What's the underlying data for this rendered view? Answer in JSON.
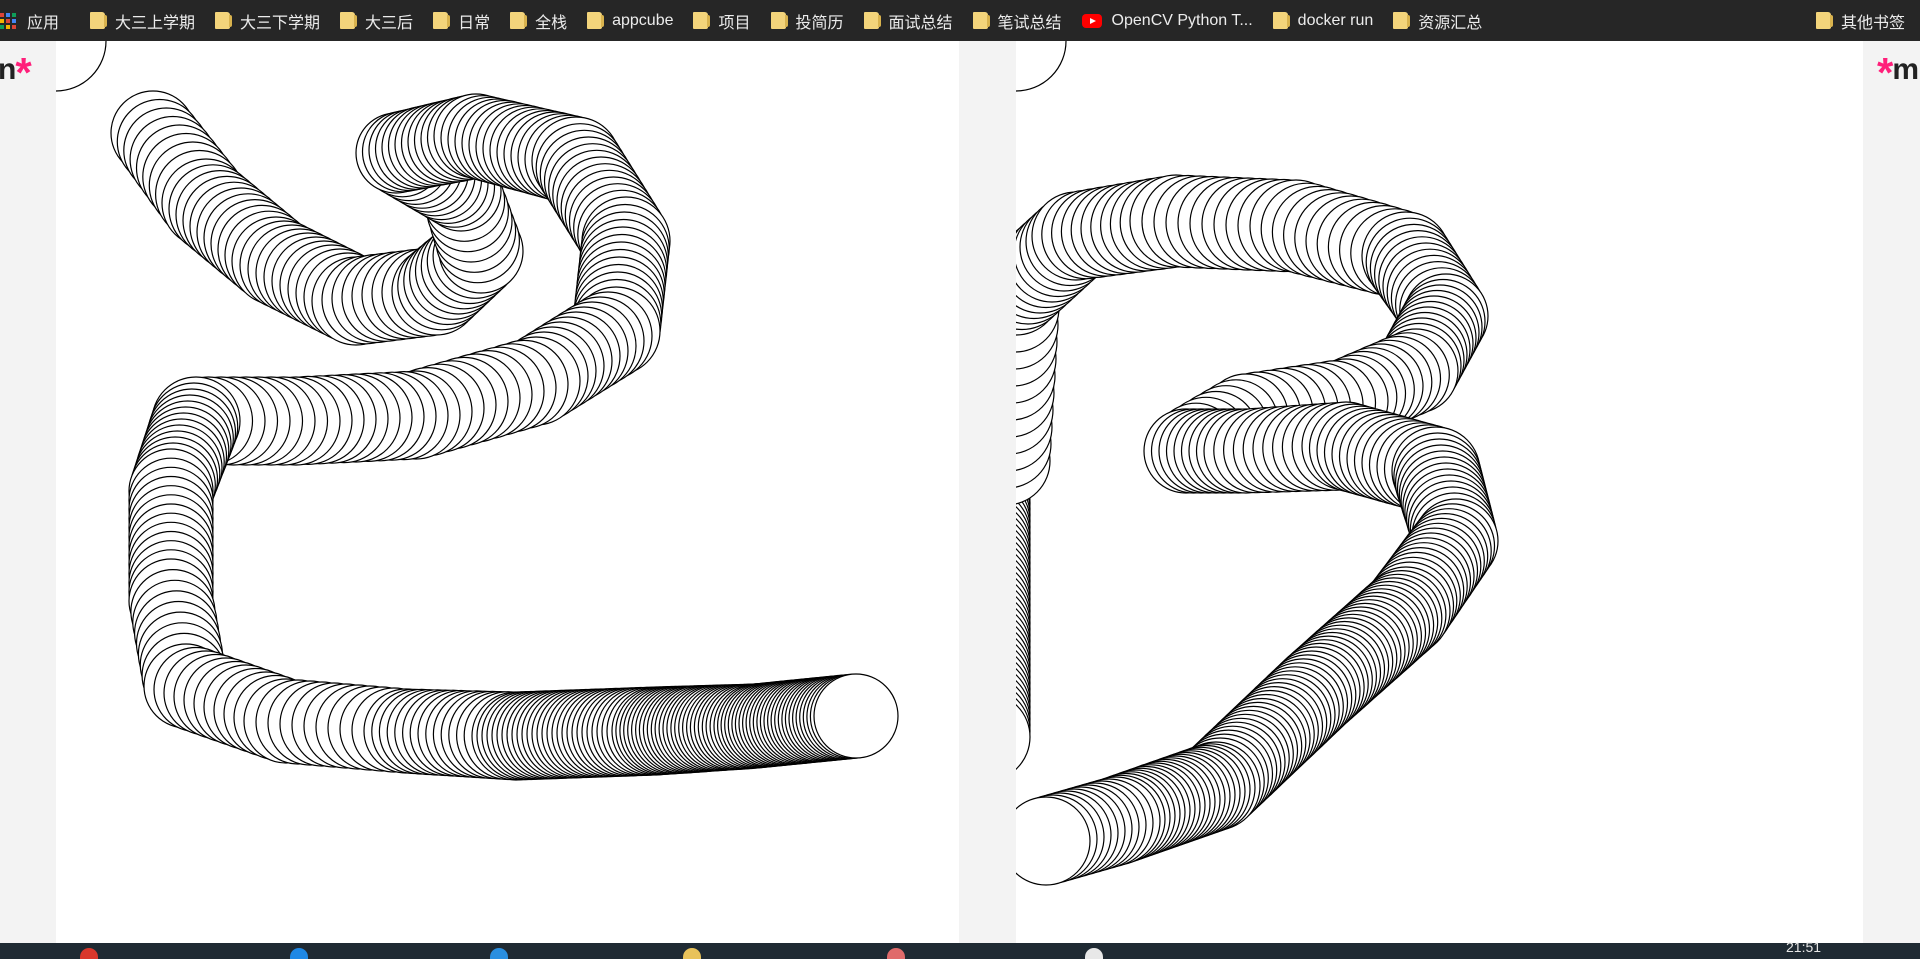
{
  "bookmarks_bar": {
    "apps_label": "应用",
    "apps_grid_colors": [
      "#db4437",
      "#4285f4",
      "#0f9d58",
      "#f4b400",
      "#db4437",
      "#4285f4",
      "#0f9d58",
      "#f4b400",
      "#db4437"
    ],
    "items": [
      {
        "label": "大三上学期",
        "icon": "folder-icon"
      },
      {
        "label": "大三下学期",
        "icon": "folder-icon"
      },
      {
        "label": "大三后",
        "icon": "folder-icon"
      },
      {
        "label": "日常",
        "icon": "folder-icon"
      },
      {
        "label": "全栈",
        "icon": "folder-icon"
      },
      {
        "label": "appcube",
        "icon": "folder-icon"
      },
      {
        "label": "项目",
        "icon": "folder-icon"
      },
      {
        "label": "投简历",
        "icon": "folder-icon"
      },
      {
        "label": "面试总结",
        "icon": "folder-icon"
      },
      {
        "label": "笔试总结",
        "icon": "folder-icon"
      },
      {
        "label": "OpenCV Python T...",
        "icon": "youtube-icon"
      },
      {
        "label": "docker run",
        "icon": "folder-icon"
      },
      {
        "label": "资源汇总",
        "icon": "folder-icon"
      }
    ],
    "other_bookmarks": "其他书签"
  },
  "page": {
    "brand_left": {
      "letter": "n",
      "star": "*"
    },
    "brand_right": {
      "letter": "m",
      "star": "*"
    },
    "brand_star_color": "#ff1f7a",
    "drawing_left_glyph": "2",
    "drawing_right_glyph": "B",
    "stroke_color": "#000000",
    "fill_color": "#ffffff"
  },
  "taskbar": {
    "clock": "21:51",
    "app_colors": [
      "#d9382c",
      "#1e88e5",
      "#2a8fe0",
      "#e8c25a",
      "#e06b6b",
      "#e8e8e8"
    ]
  }
}
